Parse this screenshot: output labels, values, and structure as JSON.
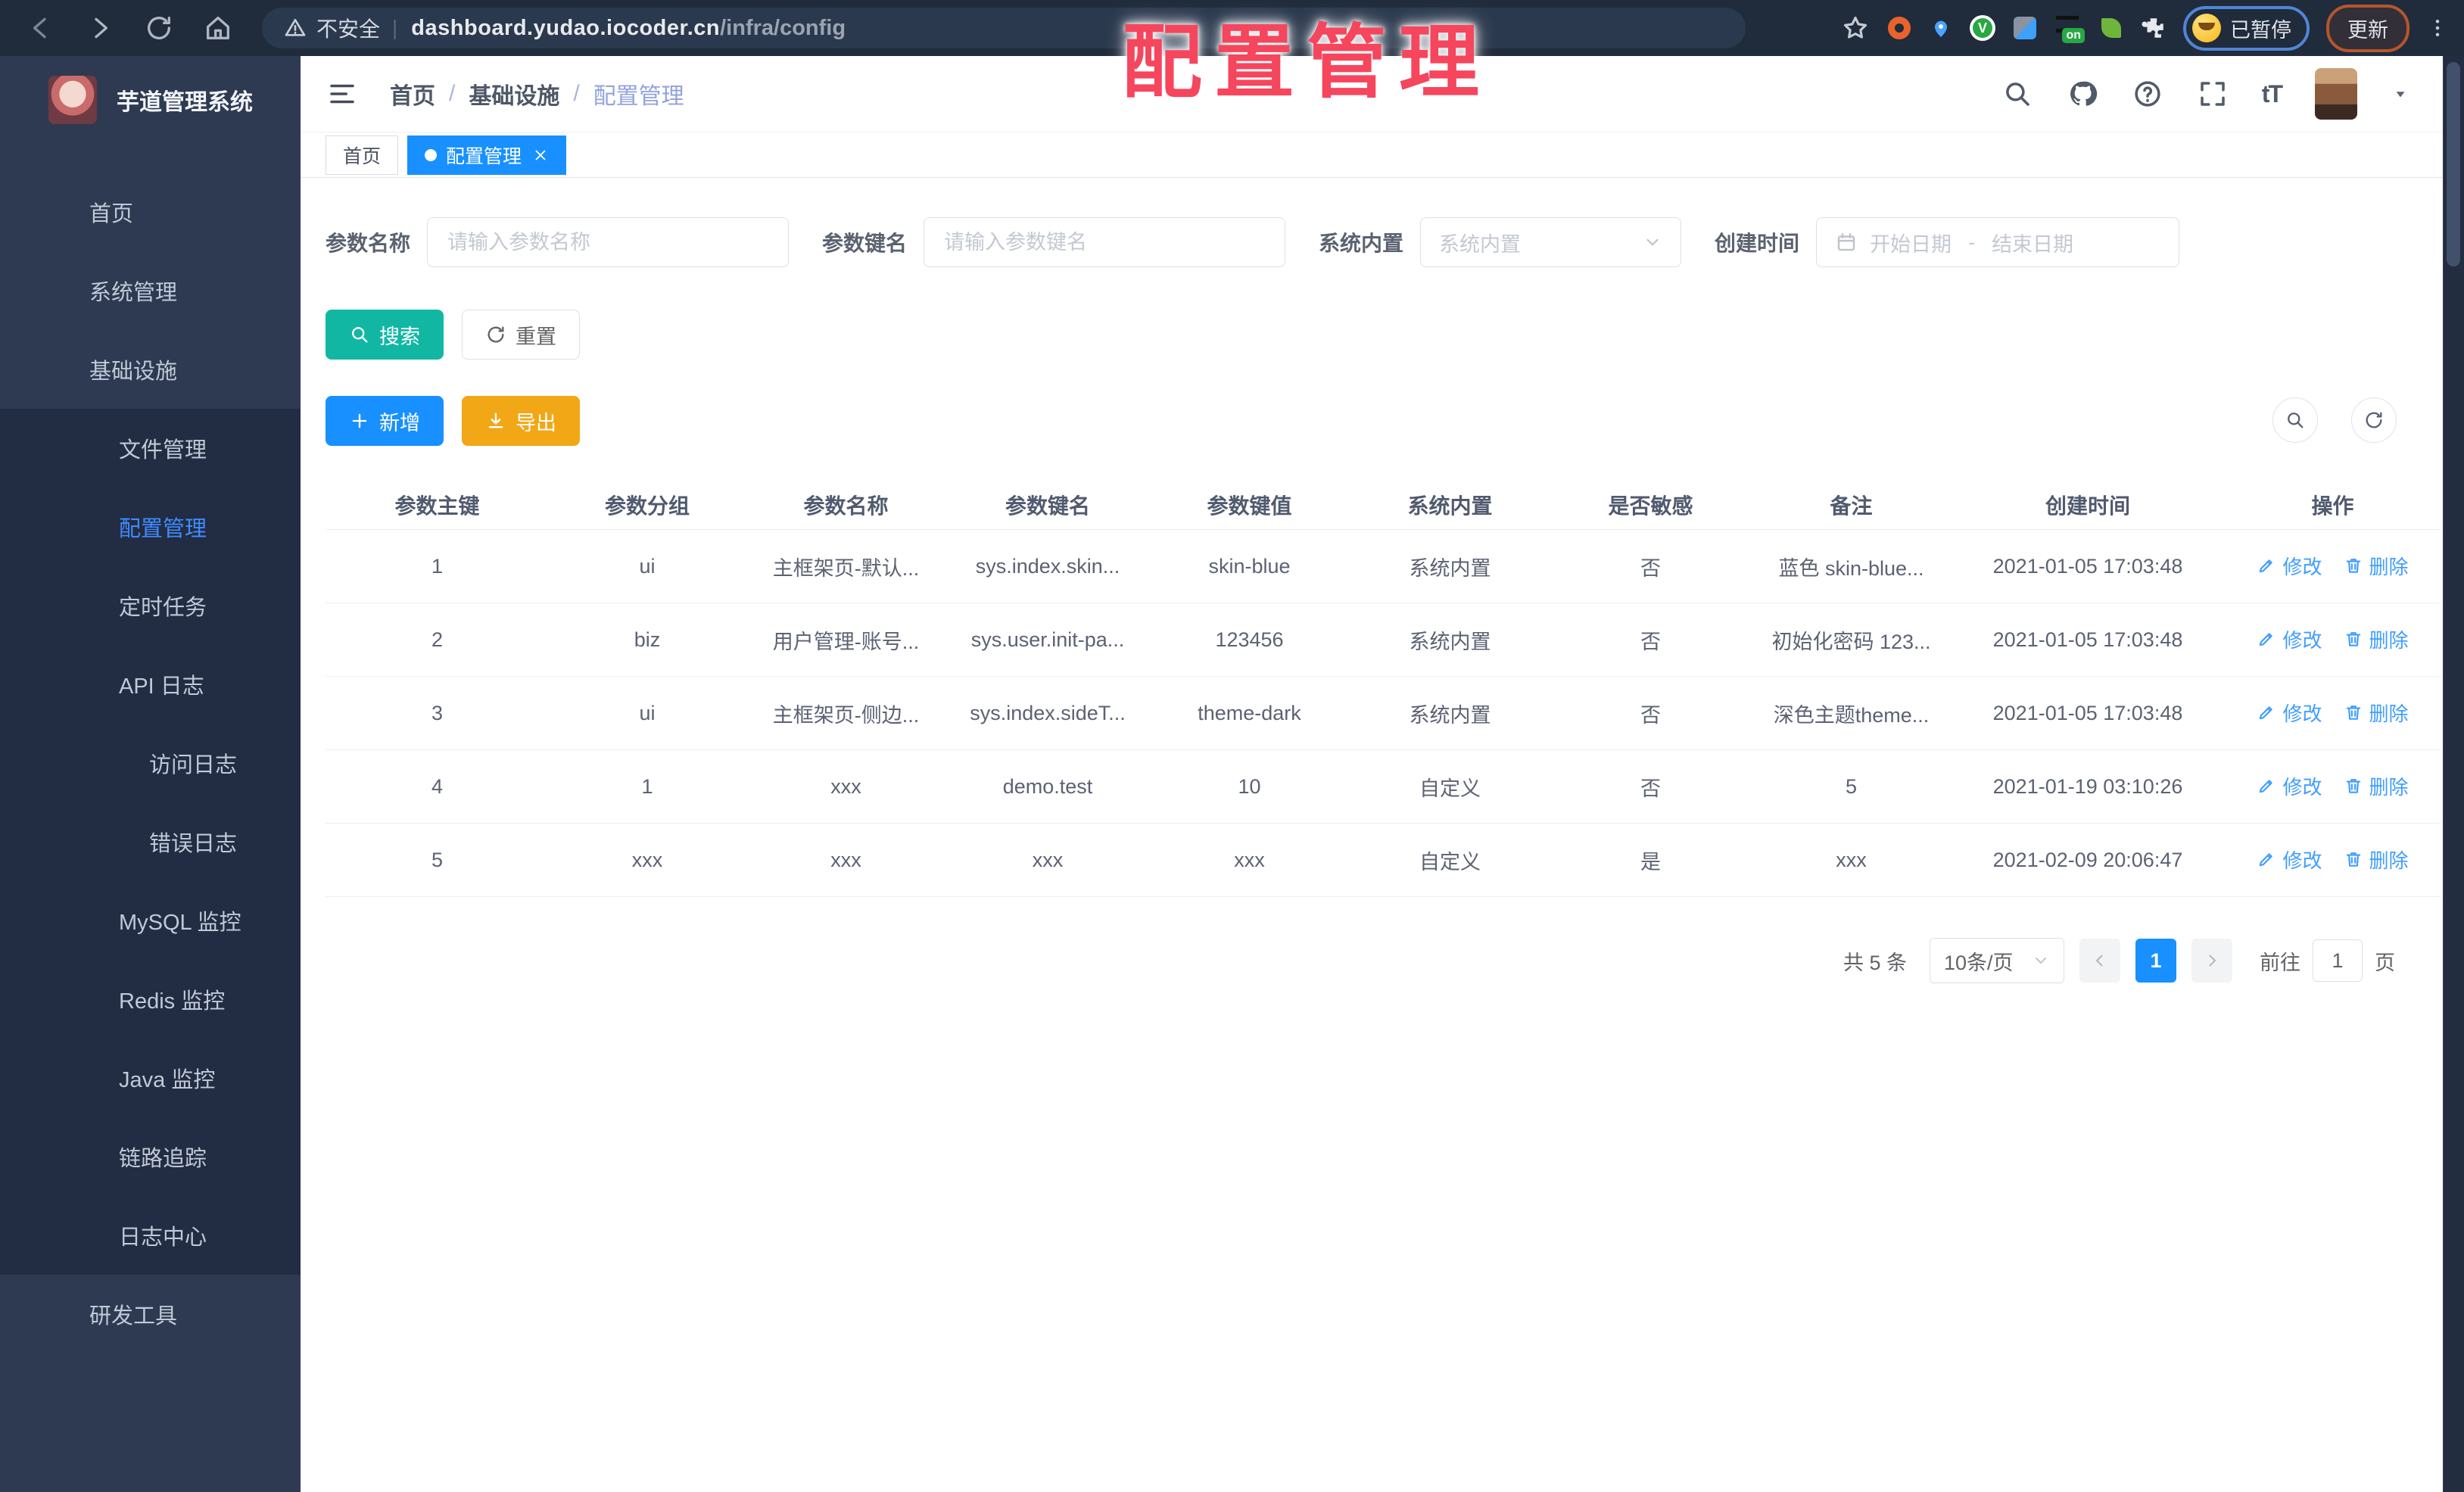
{
  "browser": {
    "security_label": "不安全",
    "url_host": "dashboard.yudao.iocoder.cn",
    "url_path": "/infra/config",
    "divider": "|",
    "on_badge": "on",
    "paused_label": "已暂停",
    "update_label": "更新"
  },
  "overlay_title": "配置管理",
  "sidebar": {
    "app_title": "芋道管理系统",
    "items": [
      {
        "id": "home",
        "label": "首页",
        "icon": "globe",
        "level": 0
      },
      {
        "id": "system",
        "label": "系统管理",
        "icon": "gear",
        "level": 0,
        "chevron": "down"
      },
      {
        "id": "infra",
        "label": "基础设施",
        "icon": "monitor",
        "level": 0,
        "chevron": "up"
      },
      {
        "id": "file",
        "label": "文件管理",
        "icon": "cloud-upload",
        "level": 1
      },
      {
        "id": "config",
        "label": "配置管理",
        "icon": "edit-square",
        "level": 1,
        "active": true
      },
      {
        "id": "job",
        "label": "定时任务",
        "icon": "clock",
        "level": 1
      },
      {
        "id": "api-log",
        "label": "API 日志",
        "icon": "log",
        "level": 1,
        "chevron": "up"
      },
      {
        "id": "access-log",
        "label": "访问日志",
        "icon": "log",
        "level": 2
      },
      {
        "id": "error-log",
        "label": "错误日志",
        "icon": "log",
        "level": 2
      },
      {
        "id": "mysql",
        "label": "MySQL 监控",
        "icon": "db",
        "level": 1
      },
      {
        "id": "redis",
        "label": "Redis 监控",
        "icon": "discs",
        "level": 1
      },
      {
        "id": "java",
        "label": "Java 监控",
        "icon": "cup",
        "level": 1
      },
      {
        "id": "tracer",
        "label": "链路追踪",
        "icon": "eye",
        "level": 1
      },
      {
        "id": "log-center",
        "label": "日志中心",
        "icon": "log",
        "level": 1
      },
      {
        "id": "dev-tools",
        "label": "研发工具",
        "icon": "briefcase",
        "level": 0,
        "chevron": "down"
      }
    ]
  },
  "breadcrumb": {
    "item1": "首页",
    "sep": "/",
    "item2": "基础设施",
    "item3": "配置管理"
  },
  "tabs": {
    "home": "首页",
    "config": "配置管理"
  },
  "filters": {
    "name_label": "参数名称",
    "name_placeholder": "请输入参数名称",
    "key_label": "参数键名",
    "key_placeholder": "请输入参数键名",
    "builtin_label": "系统内置",
    "builtin_placeholder": "系统内置",
    "time_label": "创建时间",
    "start_placeholder": "开始日期",
    "range_separator": "-",
    "end_placeholder": "结束日期"
  },
  "toolbar": {
    "search": "搜索",
    "reset": "重置",
    "add": "新增",
    "export": "导出"
  },
  "table": {
    "headers": [
      "参数主键",
      "参数分组",
      "参数名称",
      "参数键名",
      "参数键值",
      "系统内置",
      "是否敏感",
      "备注",
      "创建时间",
      "操作"
    ],
    "ops": {
      "edit": "修改",
      "delete": "删除"
    },
    "rows": [
      [
        "1",
        "ui",
        "主框架页-默认...",
        "sys.index.skin...",
        "skin-blue",
        "系统内置",
        "否",
        "蓝色 skin-blue...",
        "2021-01-05 17:03:48"
      ],
      [
        "2",
        "biz",
        "用户管理-账号...",
        "sys.user.init-pa...",
        "123456",
        "系统内置",
        "否",
        "初始化密码 123...",
        "2021-01-05 17:03:48"
      ],
      [
        "3",
        "ui",
        "主框架页-侧边...",
        "sys.index.sideT...",
        "theme-dark",
        "系统内置",
        "否",
        "深色主题theme...",
        "2021-01-05 17:03:48"
      ],
      [
        "4",
        "1",
        "xxx",
        "demo.test",
        "10",
        "自定义",
        "否",
        "5",
        "2021-01-19 03:10:26"
      ],
      [
        "5",
        "xxx",
        "xxx",
        "xxx",
        "xxx",
        "自定义",
        "是",
        "xxx",
        "2021-02-09 20:06:47"
      ]
    ]
  },
  "pagination": {
    "total": "共 5 条",
    "page_size": "10条/页",
    "current_page": "1",
    "goto_label": "前往",
    "goto_value": "1",
    "page_unit": "页"
  },
  "colors": {
    "primary": "#1890ff",
    "teal": "#12b7a4",
    "warning": "#f1a716",
    "sidebar_bg": "#2d3a52",
    "submenu_bg": "#222c42",
    "active_link": "#3f8cff",
    "overlay_red": "#f5465d",
    "browser_bar": "#202b3b"
  }
}
